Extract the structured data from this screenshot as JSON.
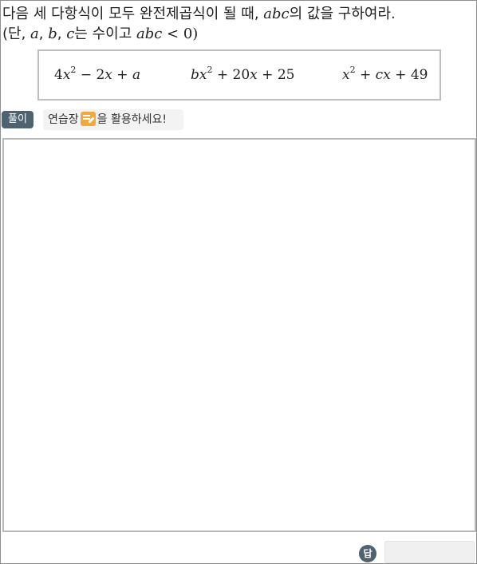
{
  "question": {
    "line1_text": "다음 세 다항식이 모두 완전제곱식이 될 때, ",
    "line1_var": "abc",
    "line1_end": "의 값을 구하여라.",
    "line2_open": "(단, ",
    "var_a": "a",
    "comma1": ", ",
    "var_b": "b",
    "comma2": ", ",
    "var_c": "c",
    "line2_mid": "는 수이고 ",
    "cond_var": "abc",
    "cond_rest": " < 0)"
  },
  "formulas": [
    {
      "coef": "4",
      "var": "x",
      "exp": "2",
      "rest1": " − 2",
      "var2": "x",
      "rest2": " + ",
      "var3": "a",
      "rest3": ""
    },
    {
      "coef": "",
      "var": "bx",
      "exp": "2",
      "rest1": " + 20",
      "var2": "x",
      "rest2": " + 25",
      "var3": "",
      "rest3": ""
    },
    {
      "coef": "",
      "var": "x",
      "exp": "2",
      "rest1": " + ",
      "var2": "cx",
      "rest2": " + 49",
      "var3": "",
      "rest3": ""
    }
  ],
  "solution_tag": "풀이",
  "hint": {
    "prefix": "연습장",
    "icon": "memo-pad-icon",
    "suffix": "을 활용하세요!"
  },
  "answer": {
    "label": "답",
    "value": ""
  },
  "colors": {
    "tag_bg": "#4f6270",
    "icon_bg": "#f2a93b",
    "border": "#b8b8b8"
  }
}
